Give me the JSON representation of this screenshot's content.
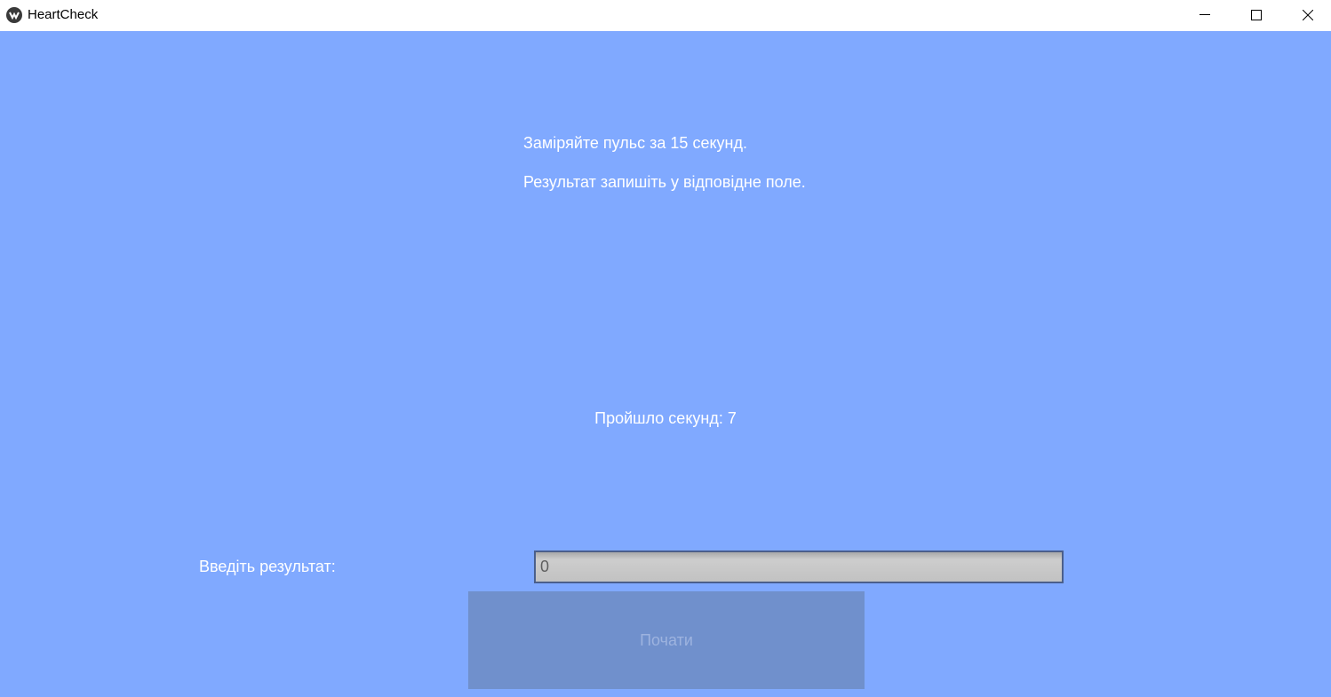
{
  "window": {
    "title": "HeartCheck",
    "app_icon": "kivy-logo-icon",
    "controls": {
      "minimize_icon": "minimize-icon",
      "maximize_icon": "maximize-icon",
      "close_icon": "close-icon"
    }
  },
  "main": {
    "instruction_line_1": "Заміряйте пульс за 15 секунд.",
    "instruction_line_2": "Результат запишіть у відповідне поле.",
    "timer_text": "Пройшло секунд: 7",
    "result_label": "Введіть результат:",
    "result_input": {
      "value": "",
      "placeholder": "0"
    },
    "start_button_label": "Почати",
    "start_button_disabled": true
  },
  "colors": {
    "background": "#80a9ff",
    "button": "#7090cc",
    "text": "#ffffff"
  }
}
